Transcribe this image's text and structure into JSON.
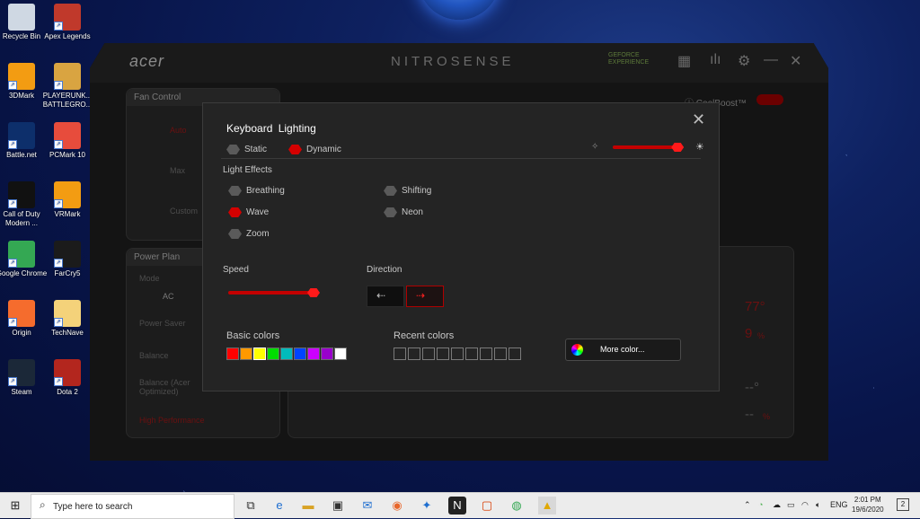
{
  "desktop_icons": [
    {
      "label": "Recycle Bin",
      "icon": "recycle-bin-icon",
      "color": "#cfd8e3"
    },
    {
      "label": "Apex Legends",
      "icon": "apex-legends-icon",
      "color": "#c0392b"
    },
    {
      "label": "3DMark",
      "icon": "3dmark-icon",
      "color": "#f39c12"
    },
    {
      "label": "PLAYERUNK... BATTLEGRO...",
      "icon": "pubg-icon",
      "color": "#d9a441"
    },
    {
      "label": "Battle.net",
      "icon": "battlenet-icon",
      "color": "#0d2f6b"
    },
    {
      "label": "PCMark 10",
      "icon": "pcmark-icon",
      "color": "#e74c3c"
    },
    {
      "label": "Call of Duty Modern ...",
      "icon": "call-of-duty-icon",
      "color": "#111111"
    },
    {
      "label": "VRMark",
      "icon": "vrmark-icon",
      "color": "#f39c12"
    },
    {
      "label": "Google Chrome",
      "icon": "chrome-icon",
      "color": "#34a853"
    },
    {
      "label": "FarCry5",
      "icon": "farcry5-icon",
      "color": "#1b1b1b"
    },
    {
      "label": "Origin",
      "icon": "origin-icon",
      "color": "#f56c2d"
    },
    {
      "label": "TechNave",
      "icon": "folder-icon",
      "color": "#f4d27a"
    },
    {
      "label": "Steam",
      "icon": "steam-icon",
      "color": "#1b2838"
    },
    {
      "label": "Dota 2",
      "icon": "dota2-icon",
      "color": "#b3261e"
    }
  ],
  "nitrosense": {
    "brand": "acer",
    "title": "NITROSENSE",
    "geforce": "GEFORCE EXPERIENCE",
    "coolboost": "CoolBoost™",
    "fan_control": {
      "title": "Fan Control",
      "options": [
        "Auto",
        "Max",
        "Custom"
      ]
    },
    "power_plan": {
      "title": "Power Plan",
      "mode": "Mode",
      "tab": "AC",
      "items": [
        "Power Saver",
        "Balance",
        "Balance (Acer Optimized)",
        "High Performance"
      ]
    },
    "stats": {
      "temp1": "77°",
      "fan1": "9",
      "fan1_unit": "%",
      "temp2": "--°",
      "fan2": "--",
      "fan2_unit": "%"
    }
  },
  "keyboard_lighting": {
    "title": "Keyboard Lighting",
    "modes": [
      {
        "label": "Static",
        "selected": false
      },
      {
        "label": "Dynamic",
        "selected": true
      }
    ],
    "brightness": 0.95,
    "light_effects_title": "Light Effects",
    "effects": [
      {
        "label": "Breathing",
        "selected": false
      },
      {
        "label": "Wave",
        "selected": true
      },
      {
        "label": "Zoom",
        "selected": false
      },
      {
        "label": "Shifting",
        "selected": false
      },
      {
        "label": "Neon",
        "selected": false
      }
    ],
    "speed_title": "Speed",
    "speed": 0.95,
    "direction_title": "Direction",
    "direction": "right",
    "basic_colors_title": "Basic colors",
    "basic_colors": [
      "#ff0000",
      "#ff9900",
      "#ffff00",
      "#00dd00",
      "#00bbbb",
      "#0044ff",
      "#cc00ff",
      "#9900cc",
      "#ffffff"
    ],
    "selected_color": "#ffff00",
    "recent_colors_title": "Recent colors",
    "recent_colors_count": 9,
    "more_color_label": "More color..."
  },
  "taskbar": {
    "search_placeholder": "Type here to search",
    "language": "ENG",
    "time": "2:01 PM",
    "date": "19/6/2020",
    "notification_count": "2"
  }
}
